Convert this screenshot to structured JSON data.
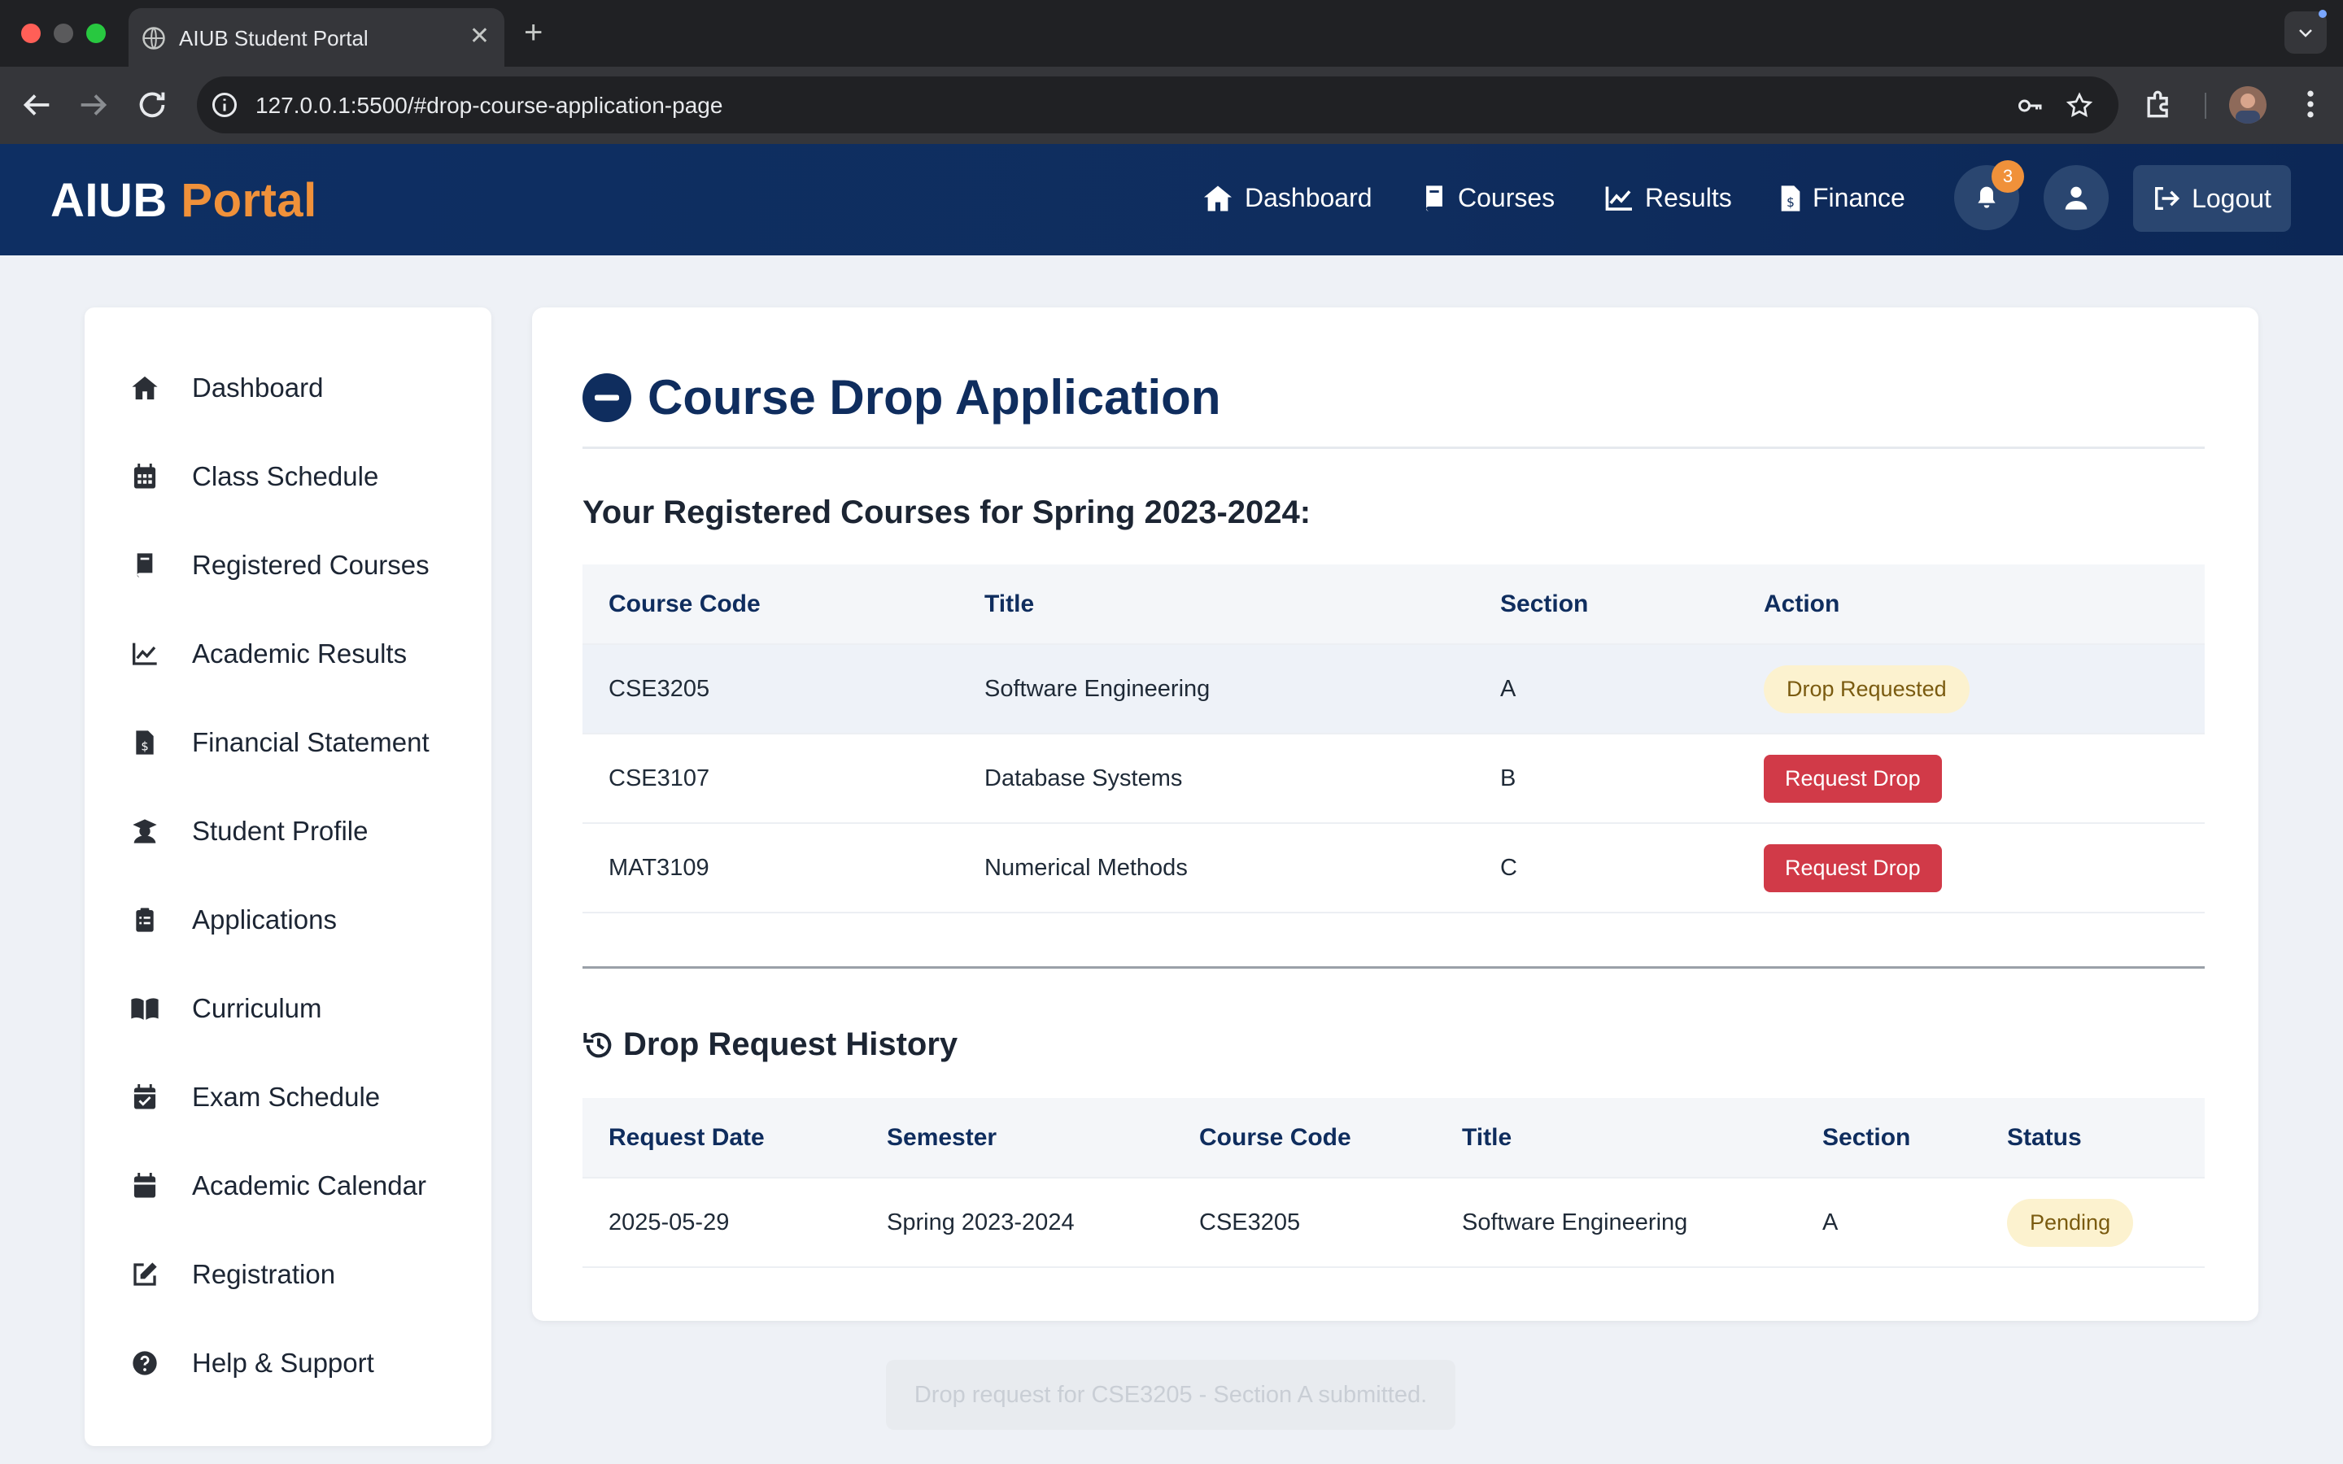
{
  "browser": {
    "tab_title": "AIUB Student Portal",
    "url": "127.0.0.1:5500/#drop-course-application-page"
  },
  "header": {
    "brand_primary": "AIUB",
    "brand_secondary": "Portal",
    "nav": [
      "Dashboard",
      "Courses",
      "Results",
      "Finance"
    ],
    "notification_count": "3",
    "logout_label": "Logout"
  },
  "sidebar": {
    "items": [
      {
        "label": "Dashboard",
        "icon": "home-icon"
      },
      {
        "label": "Class Schedule",
        "icon": "calendar-grid-icon"
      },
      {
        "label": "Registered Courses",
        "icon": "book-icon"
      },
      {
        "label": "Academic Results",
        "icon": "chart-line-icon"
      },
      {
        "label": "Financial Statement",
        "icon": "invoice-dollar-icon"
      },
      {
        "label": "Student Profile",
        "icon": "graduate-icon"
      },
      {
        "label": "Applications",
        "icon": "clipboard-icon"
      },
      {
        "label": "Curriculum",
        "icon": "open-book-icon"
      },
      {
        "label": "Exam Schedule",
        "icon": "calendar-check-icon"
      },
      {
        "label": "Academic Calendar",
        "icon": "calendar-icon"
      },
      {
        "label": "Registration",
        "icon": "edit-icon"
      },
      {
        "label": "Help & Support",
        "icon": "question-circle-icon"
      }
    ]
  },
  "page": {
    "title": "Course Drop Application",
    "registered_heading": "Your Registered Courses for Spring 2023-2024:",
    "registered_table": {
      "headers": [
        "Course Code",
        "Title",
        "Section",
        "Action"
      ],
      "rows": [
        {
          "code": "CSE3205",
          "title": "Software Engineering",
          "section": "A",
          "action": "Drop Requested"
        },
        {
          "code": "CSE3107",
          "title": "Database Systems",
          "section": "B",
          "action": "Request Drop"
        },
        {
          "code": "MAT3109",
          "title": "Numerical Methods",
          "section": "C",
          "action": "Request Drop"
        }
      ]
    },
    "history_heading": "Drop Request History",
    "history_table": {
      "headers": [
        "Request Date",
        "Semester",
        "Course Code",
        "Title",
        "Section",
        "Status"
      ],
      "rows": [
        {
          "date": "2025-05-29",
          "semester": "Spring 2023-2024",
          "code": "CSE3205",
          "title": "Software Engineering",
          "section": "A",
          "status": "Pending"
        }
      ]
    }
  },
  "toast": "Drop request for CSE3205 - Section A submitted.",
  "colors": {
    "brand_navy": "#0f2d5e",
    "brand_orange": "#f0913a",
    "danger": "#d13a48",
    "pending_bg": "#fcf2cf"
  }
}
